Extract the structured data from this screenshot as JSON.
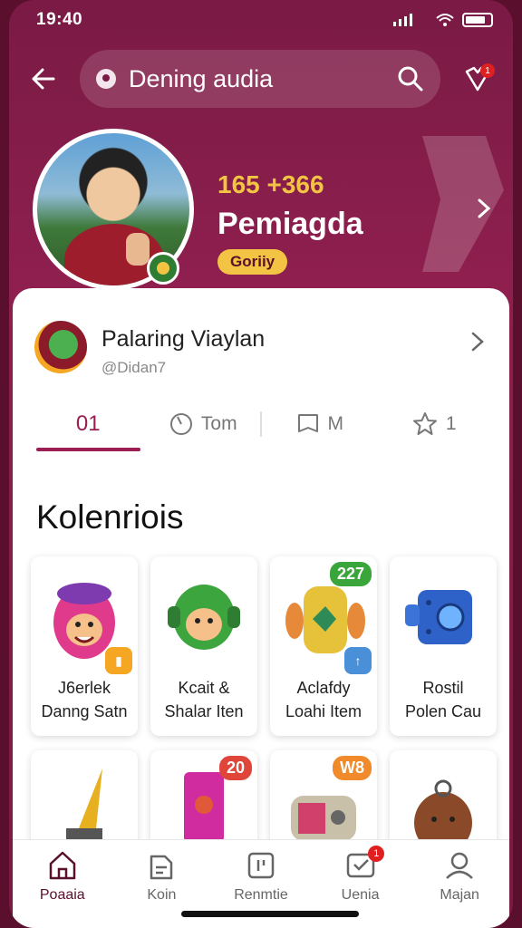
{
  "status": {
    "time": "19:40"
  },
  "search": {
    "text": "Dening audia"
  },
  "notifications": {
    "badge": "1"
  },
  "profile": {
    "coins": "165 +366",
    "name": "Pemiagda",
    "pill": "Goriiy"
  },
  "user_card": {
    "name": "Palaring Viaylan",
    "handle": "@Didan7"
  },
  "tabs": [
    {
      "label": "01"
    },
    {
      "label": "Tom"
    },
    {
      "label": "M"
    },
    {
      "label": "1"
    }
  ],
  "section": {
    "title": "Kolenriois"
  },
  "items": [
    {
      "line1": "J6erlek",
      "line2": "Danng Satn",
      "tag": ""
    },
    {
      "line1": "Kcait &",
      "line2": "Shalar Iten",
      "tag": ""
    },
    {
      "line1": "Aclafdy",
      "line2": "Loahi Item",
      "tag": "227"
    },
    {
      "line1": "Rostil",
      "line2": "Polen Cau",
      "tag": ""
    }
  ],
  "items2": [
    {
      "tag": ""
    },
    {
      "tag": "20"
    },
    {
      "tag": "W8"
    },
    {
      "tag": ""
    }
  ],
  "nav": [
    {
      "label": "Poaaia"
    },
    {
      "label": "Koin"
    },
    {
      "label": "Renmtie"
    },
    {
      "label": "Uenia",
      "badge": "1"
    },
    {
      "label": "Majan"
    }
  ],
  "colors": {
    "brand": "#7a1a45",
    "accent": "#9a1e52",
    "gold": "#f3c443"
  }
}
